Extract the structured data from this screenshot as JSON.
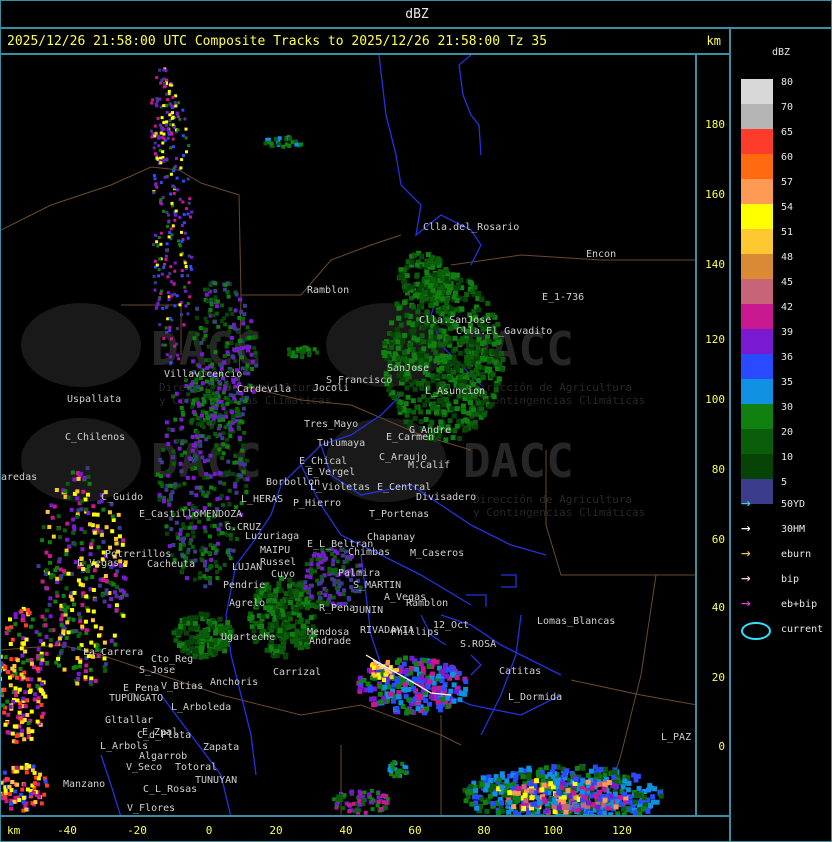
{
  "top_title": "dBZ",
  "header": {
    "title": "2025/12/26 21:58:00 UTC Composite Tracks to 2025/12/26 21:58:00 Tz 35",
    "unit": "km"
  },
  "axes": {
    "y_ticks": [
      "180",
      "160",
      "140",
      "120",
      "100",
      "80",
      "60",
      "40",
      "20",
      "0"
    ],
    "x_ticks": [
      "-40",
      "-20",
      "0",
      "20",
      "40",
      "60",
      "80",
      "100",
      "120"
    ],
    "x_unit": "km"
  },
  "legend": {
    "title": "dBZ",
    "levels": [
      {
        "label": "80",
        "color": "#d8d8d8"
      },
      {
        "label": "70",
        "color": "#b4b4b4"
      },
      {
        "label": "65",
        "color": "#ff3b2b"
      },
      {
        "label": "60",
        "color": "#ff6a10"
      },
      {
        "label": "57",
        "color": "#ff9a55"
      },
      {
        "label": "54",
        "color": "#ffff00"
      },
      {
        "label": "51",
        "color": "#ffc830"
      },
      {
        "label": "48",
        "color": "#d98a34"
      },
      {
        "label": "45",
        "color": "#c86478"
      },
      {
        "label": "42",
        "color": "#c81890"
      },
      {
        "label": "39",
        "color": "#7a1ad0"
      },
      {
        "label": "36",
        "color": "#2a4aff"
      },
      {
        "label": "35",
        "color": "#1090e0"
      },
      {
        "label": "30",
        "color": "#108010"
      },
      {
        "label": "20",
        "color": "#0a5e0a"
      },
      {
        "label": "10",
        "color": "#064406"
      },
      {
        "label": "5",
        "color": "#3c3c8c"
      }
    ],
    "tracks": [
      {
        "label": "50YD",
        "color": "#40d0e0"
      },
      {
        "label": "30HM",
        "color": "#ffffff"
      },
      {
        "label": "eburn",
        "color": "#f0c060"
      },
      {
        "label": "bip",
        "color": "#ffd0e0"
      },
      {
        "label": "eb+bip",
        "color": "#e040e0"
      },
      {
        "label": "current",
        "color": "#30e0ff"
      }
    ]
  },
  "places": [
    {
      "name": "Clla.del_Rosario"
    },
    {
      "name": "Encon"
    },
    {
      "name": "E_1-736"
    },
    {
      "name": "Ramblon"
    },
    {
      "name": "Clla.SanJose"
    },
    {
      "name": "Clla.El_Gavadito"
    },
    {
      "name": "Villavicencio"
    },
    {
      "name": "Jocoli"
    },
    {
      "name": "Cardevila"
    },
    {
      "name": "S_Francisco"
    },
    {
      "name": "SanJose"
    },
    {
      "name": "L_Asuncion"
    },
    {
      "name": "Uspallata"
    },
    {
      "name": "Tres_Mayo"
    },
    {
      "name": "Tulumaya"
    },
    {
      "name": "G_Andre"
    },
    {
      "name": "E_Carmen"
    },
    {
      "name": "C_Chilenos"
    },
    {
      "name": "C_Araujo"
    },
    {
      "name": "E_Chical"
    },
    {
      "name": "E_Vergel"
    },
    {
      "name": "M.Calif"
    },
    {
      "name": "Borbollon"
    },
    {
      "name": "L_Violetas"
    },
    {
      "name": "E_Central"
    },
    {
      "name": "C_Guido"
    },
    {
      "name": "L_HERAS"
    },
    {
      "name": "P_Hierro"
    },
    {
      "name": "Divisadero"
    },
    {
      "name": "E_Castillo"
    },
    {
      "name": "MENDOZA"
    },
    {
      "name": "T_Portenas"
    },
    {
      "name": "G.CRUZ"
    },
    {
      "name": "Luzuriaga"
    },
    {
      "name": "Chapanay"
    },
    {
      "name": "E_L_Beltran"
    },
    {
      "name": "Chimbas"
    },
    {
      "name": "M_Caseros"
    },
    {
      "name": "MAIPU"
    },
    {
      "name": "Potrerillos"
    },
    {
      "name": "Cacheuta"
    },
    {
      "name": "L_Vegas"
    },
    {
      "name": "Russel"
    },
    {
      "name": "LUJAN"
    },
    {
      "name": "Cuyo"
    },
    {
      "name": "Pendrie"
    },
    {
      "name": "Palmira"
    },
    {
      "name": "S_MARTIN"
    },
    {
      "name": "A_Vegas"
    },
    {
      "name": "Ramblon"
    },
    {
      "name": "Agrelo"
    },
    {
      "name": "R_Pena"
    },
    {
      "name": "JUNIN"
    },
    {
      "name": "Ugarteche"
    },
    {
      "name": "Mendosa"
    },
    {
      "name": "Andrade"
    },
    {
      "name": "RIVADAVIA"
    },
    {
      "name": "Phillips"
    },
    {
      "name": "12_Oct"
    },
    {
      "name": "Lomas_Blancas"
    },
    {
      "name": "S.ROSA"
    },
    {
      "name": "La_Carrera"
    },
    {
      "name": "Cto_Reg"
    },
    {
      "name": "S_Jose"
    },
    {
      "name": "Carrizal"
    },
    {
      "name": "Catitas"
    },
    {
      "name": "V_Btias"
    },
    {
      "name": "Anchoris"
    },
    {
      "name": "E_Pena"
    },
    {
      "name": "TUPUNGATO"
    },
    {
      "name": "L_Dormida"
    },
    {
      "name": "L_Arboleda"
    },
    {
      "name": "Gltallar"
    },
    {
      "name": "E_Zpal"
    },
    {
      "name": "C_d_Plata"
    },
    {
      "name": "L_Arbols"
    },
    {
      "name": "Zapata"
    },
    {
      "name": "L_PAZ"
    },
    {
      "name": "Algarrob"
    },
    {
      "name": "V_Seco"
    },
    {
      "name": "Totoral"
    },
    {
      "name": "TUNUYAN"
    },
    {
      "name": "Manzano"
    },
    {
      "name": "C_L_Rosas"
    },
    {
      "name": "V_Flores"
    },
    {
      "name": "aredas"
    }
  ],
  "watermark": {
    "brand": "DACC",
    "line1": "Dirección de Agricultura",
    "line2": "y Contingencias Climáticas"
  }
}
